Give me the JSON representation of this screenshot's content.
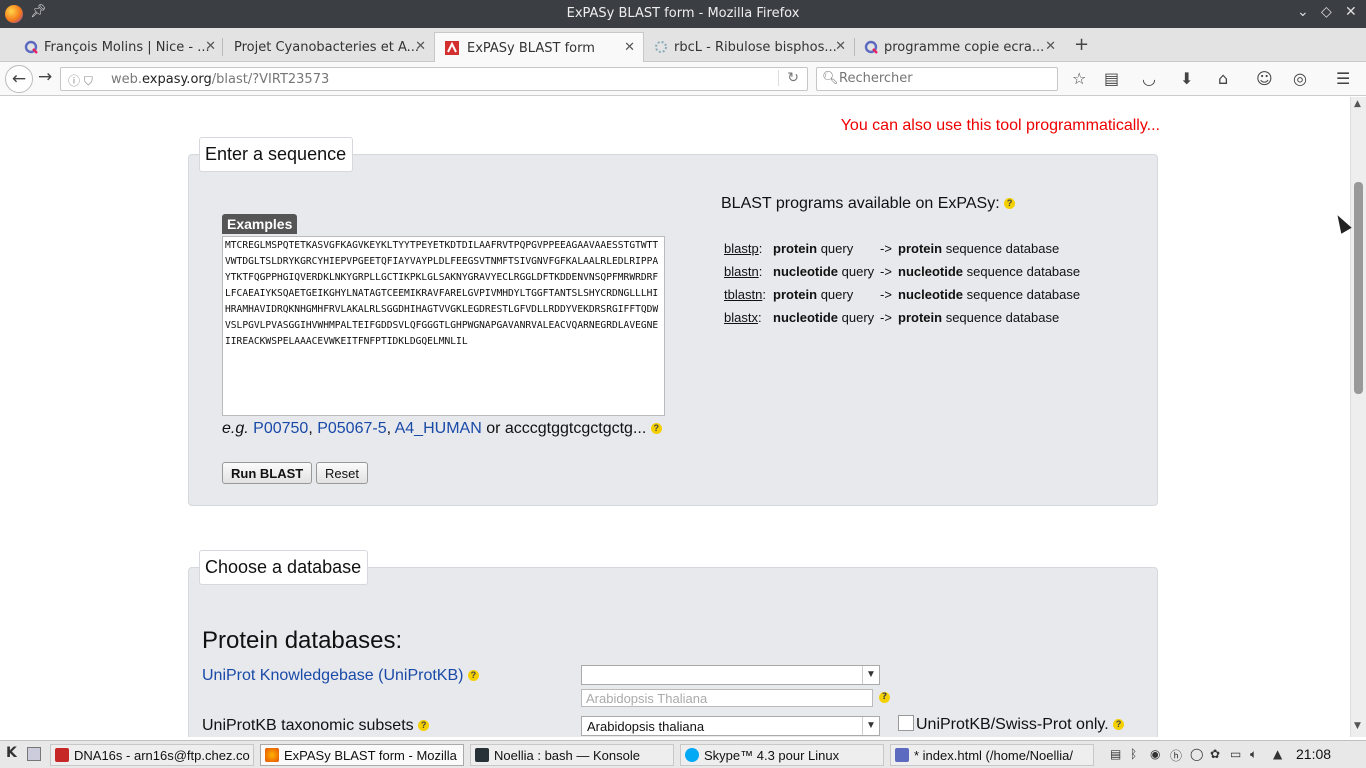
{
  "window": {
    "title": "ExPASy BLAST form - Mozilla Firefox",
    "pin_icon": "pin-icon",
    "controls": [
      "minimize",
      "maximize",
      "close"
    ]
  },
  "tabs": [
    {
      "label": "François Molins | Nice - ...",
      "icon": "qwant-icon",
      "active": false
    },
    {
      "label": "Projet Cyanobacteries et A...",
      "icon": "none",
      "active": false
    },
    {
      "label": "ExPASy BLAST form",
      "icon": "expasy-icon",
      "active": true
    },
    {
      "label": "rbcL - Ribulose bisphos...",
      "icon": "loading-icon",
      "active": false
    },
    {
      "label": "programme copie ecra...",
      "icon": "qwant-icon",
      "active": false
    }
  ],
  "navbar": {
    "url_domain_prefix": "web.",
    "url_domain": "expasy.org",
    "url_path": "/blast/?VIRT23573",
    "search_placeholder": "Rechercher"
  },
  "page": {
    "programmatic_link": "You can also use this tool programmatically...",
    "sequence_section_title": "Enter a sequence",
    "examples_label": "Examples",
    "sequence_value": "MTCREGLMSPQTETKASVGFKAGVKEYKLTYYTPEYETKDTDILAAFRVTPQPGVPPEEAGAAVAAESSTGTWTTVWTDGLTSLDRYKGRCYHIEPVPGEETQFIAYVAYPLDLFEEGSVTNMFTSIVGNVFGFKALAALRLEDLRIPPAYTKTFQGPPHGIQVERDKLNKYGRPLLGCTIKPKLGLSAKNYGRAVYECLRGGLDFTKDDENVNSQPFMRWRDRFLFCAEAIYKSQAETGEIKGHYLNATAGTCEEMIKRAVFARELGVPIVMHDYLTGGFTANTSLSHYCRDNGLLLHIHRAMHAVIDRQKNHGMHFRVLAKALRLSGGDHIHAGTVVGKLEGDRESTLGFVDLLRDDYVEKDRSRGIFFTQDWVSLPGVLPVASGGIHVWHMPALTEIFGDDSVLQFGGGTLGHPWGNAPGAVANRVALEACVQARNEGRDLAVEGNEIIREACKWSPELAAACEVWKEITFNFPTIDKLDGQELMNLIL",
    "example_prefix": "e.g.",
    "example_links": [
      "P00750",
      "P05067-5",
      "A4_HUMAN"
    ],
    "example_suffix": "or acccgtggtcgctgctg...",
    "run_button": "Run BLAST",
    "reset_button": "Reset",
    "programs_title": "BLAST programs available on ExPASy:",
    "programs": [
      {
        "name": "blastp",
        "query": "protein",
        "q_word": "query",
        "arrow": "->",
        "db": "protein",
        "db_word": "sequence database"
      },
      {
        "name": "blastn",
        "query": "nucleotide",
        "q_word": "query",
        "arrow": "->",
        "db": "nucleotide",
        "db_word": "sequence database"
      },
      {
        "name": "tblastn",
        "query": "protein",
        "q_word": "query",
        "arrow": "->",
        "db": "nucleotide",
        "db_word": "sequence database"
      },
      {
        "name": "blastx",
        "query": "nucleotide",
        "q_word": "query",
        "arrow": "->",
        "db": "protein",
        "db_word": "sequence database"
      }
    ],
    "database_section_title": "Choose a database",
    "protein_db_title": "Protein databases:",
    "uniprot_link": "UniProt Knowledgebase (UniProtKB)",
    "uniprot_select_value": "",
    "taxonomy_placeholder": "Arabidopsis Thaliana",
    "taxonomic_subsets_label": "UniProtKB taxonomic subsets",
    "taxonomic_subsets_value": "Arabidopsis thaliana",
    "swissprot_only_label": "UniProtKB/Swiss-Prot only."
  },
  "taskbar": {
    "items": [
      {
        "label": "DNA16s - arn16s@ftp.chez.co",
        "icon": "filezilla-icon",
        "active": false
      },
      {
        "label": "ExPASy BLAST form - Mozilla",
        "icon": "firefox-icon",
        "active": true
      },
      {
        "label": "Noellia : bash — Konsole",
        "icon": "terminal-icon",
        "active": false
      },
      {
        "label": "Skype™ 4.3 pour Linux",
        "icon": "skype-icon",
        "active": false
      },
      {
        "label": "* index.html (/home/Noellia/",
        "icon": "editor-icon",
        "active": false
      }
    ],
    "clock": "21:08"
  },
  "colors": {
    "accent_link": "#1a4aa8",
    "programmatic_red": "#e00000",
    "panel_bg": "#e7e9ed",
    "help_yellow": "#f4d000"
  }
}
